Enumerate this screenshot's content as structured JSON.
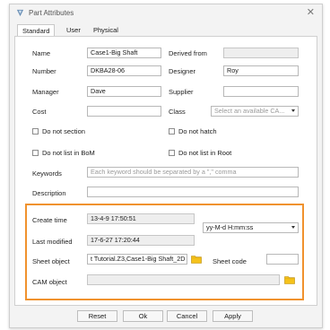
{
  "window": {
    "title": "Part Attributes",
    "close_glyph": "✕"
  },
  "tabs": [
    {
      "label": "Standard"
    },
    {
      "label": "User"
    },
    {
      "label": "Physical"
    }
  ],
  "form": {
    "name": {
      "label": "Name",
      "value": "Case1-Big Shaft"
    },
    "derived_from": {
      "label": "Derived from",
      "value": ""
    },
    "number": {
      "label": "Number",
      "value": "DKBA28-06"
    },
    "designer": {
      "label": "Designer",
      "value": "Roy"
    },
    "manager": {
      "label": "Manager",
      "value": "Dave"
    },
    "supplier": {
      "label": "Supplier",
      "value": ""
    },
    "cost": {
      "label": "Cost",
      "value": ""
    },
    "class": {
      "label": "Class",
      "placeholder": "Select an available CA..."
    },
    "do_not_section": {
      "label": "Do not section"
    },
    "do_not_hatch": {
      "label": "Do not hatch"
    },
    "do_not_list_bom": {
      "label": "Do not list in BoM"
    },
    "do_not_list_root": {
      "label": "Do not list in Root"
    },
    "keywords": {
      "label": "Keywords",
      "placeholder": "Each keyword should be separated by a \",\" comma"
    },
    "description": {
      "label": "Description",
      "value": ""
    }
  },
  "group": {
    "create_time": {
      "label": "Create time",
      "value": "13-4-9 17:50:51"
    },
    "last_modified": {
      "label": "Last modified",
      "value": "17-6-27 17:20:44"
    },
    "date_format": {
      "value": "yy-M-d H:mm:ss"
    },
    "sheet_object": {
      "label": "Sheet object",
      "value": "t Tutorial.Z3,Case1-Big Shaft_2D"
    },
    "sheet_code": {
      "label": "Sheet code",
      "value": ""
    },
    "cam_object": {
      "label": "CAM object",
      "value": ""
    }
  },
  "buttons": {
    "reset": "Reset",
    "ok": "Ok",
    "cancel": "Cancel",
    "apply": "Apply"
  },
  "colors": {
    "highlight_border": "#f0922e",
    "folder": "#f5c21b"
  }
}
